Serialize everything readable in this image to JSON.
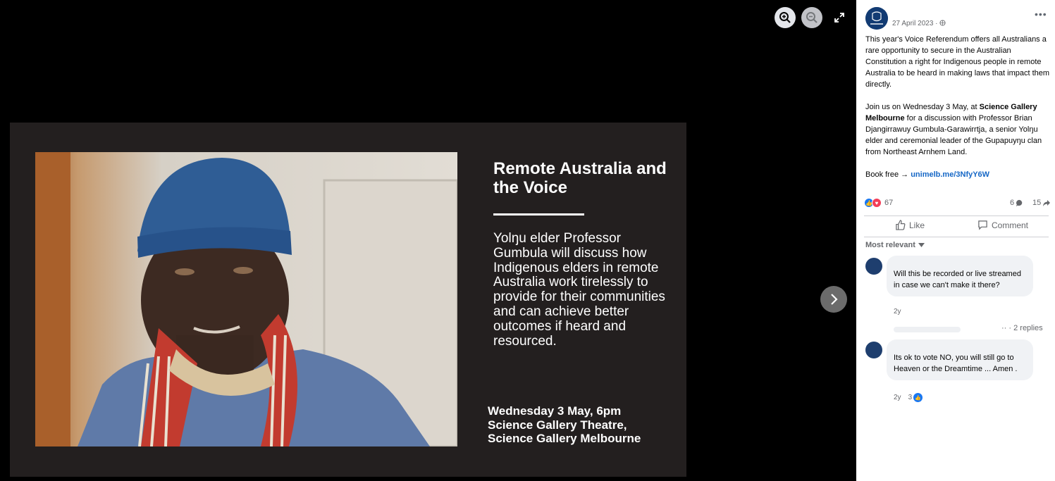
{
  "viewer": {
    "slide": {
      "title": "Remote Australia and the Voice",
      "body": "Yolŋu elder Professor Gumbula will discuss how Indigenous elders in remote Australia work tirelessly to provide for their communities and can achieve better outcomes if heard and resourced.",
      "event_line1": "Wednesday 3 May, 6pm",
      "event_line2": "Science Gallery Theatre,",
      "event_line3": "Science Gallery Melbourne"
    },
    "icons": {
      "zoom_in": "zoom-in-icon",
      "zoom_out": "zoom-out-icon",
      "fullscreen": "fullscreen-icon",
      "next": "chevron-right-icon"
    }
  },
  "post": {
    "date": "27 April 2023 · ",
    "more": "•••",
    "para1": "This year's Voice Referendum offers all Australians a rare opportunity to secure in the Australian Constitution a right for Indigenous people in remote Australia to be heard in making laws that impact them directly.",
    "para2_prefix": "Join us on Wednesday 3 May, at ",
    "para2_bold": "Science Gallery Melbourne",
    "para2_suffix": " for a discussion with Professor Brian Djangirrawuy Gumbula-Garawirrtja, a senior Yolŋu elder and ceremonial leader of the Gupapuyŋu clan from Northeast Arnhem Land.",
    "book_prefix": "Book free → ",
    "book_link": "unimelb.me/3NfyY6W",
    "reaction_count": "67",
    "comment_count": "6",
    "share_count": "15",
    "like_label": "Like",
    "comment_label": "Comment",
    "sort_label": "Most relevant"
  },
  "comments": [
    {
      "text": "Will this be recorded or live streamed in case we can't make it there?",
      "time": "2y",
      "replies": "·· · 2 replies"
    },
    {
      "text": "Its ok to vote NO, you will still go to Heaven or the Dreamtime ... Amen .",
      "time": "2y",
      "likes": "3"
    }
  ],
  "colors": {
    "slide_bg": "#231f1f",
    "link": "#1567c6",
    "like_blue": "#1877f2",
    "love_red": "#f33e58"
  }
}
